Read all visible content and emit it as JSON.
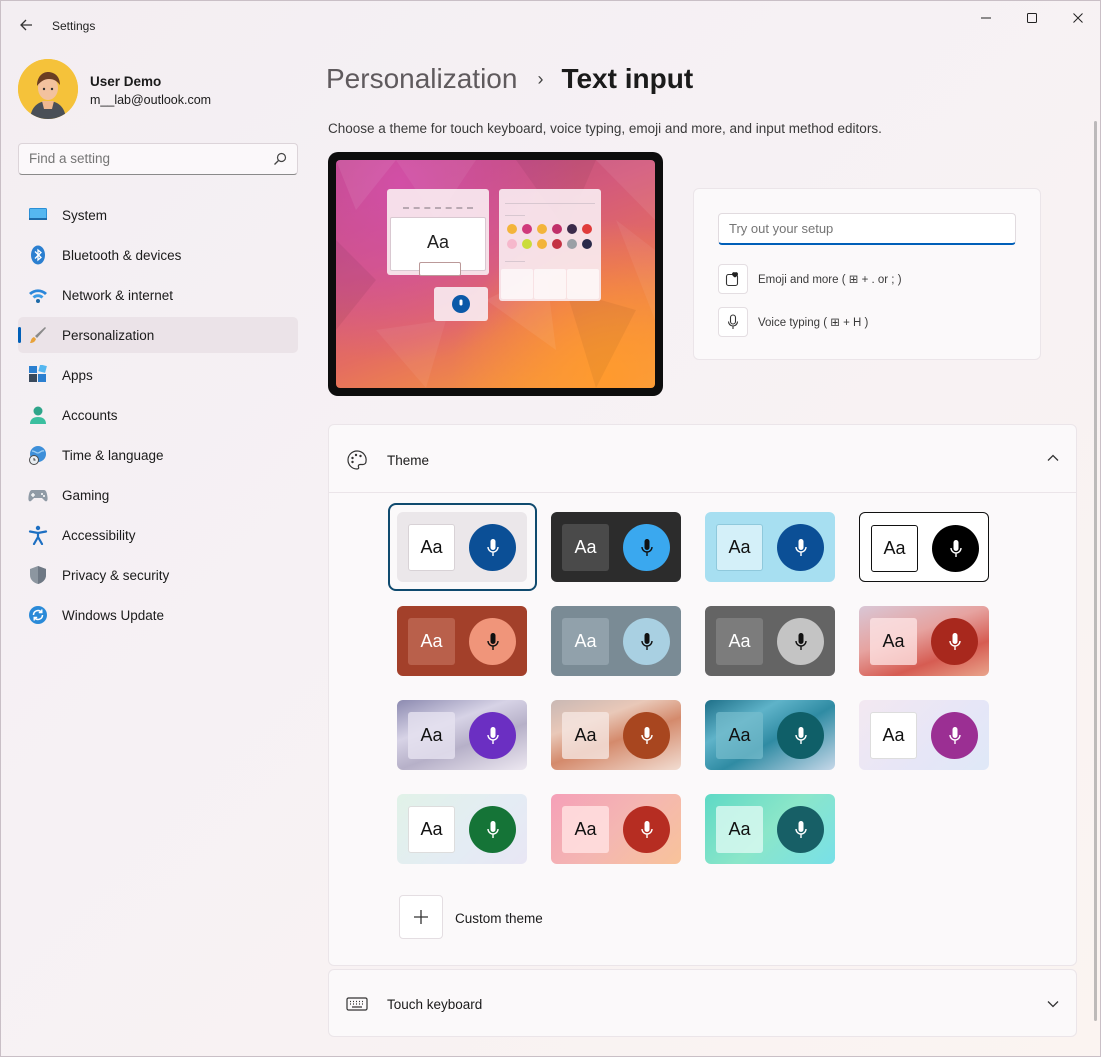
{
  "window": {
    "title": "Settings"
  },
  "profile": {
    "name": "User Demo",
    "email": "m__lab@outlook.com"
  },
  "search": {
    "placeholder": "Find a setting"
  },
  "nav": {
    "items": [
      {
        "label": "System",
        "icon": "monitor-icon",
        "selected": false
      },
      {
        "label": "Bluetooth & devices",
        "icon": "bluetooth-icon",
        "selected": false
      },
      {
        "label": "Network & internet",
        "icon": "wifi-icon",
        "selected": false
      },
      {
        "label": "Personalization",
        "icon": "brush-icon",
        "selected": true
      },
      {
        "label": "Apps",
        "icon": "apps-icon",
        "selected": false
      },
      {
        "label": "Accounts",
        "icon": "person-icon",
        "selected": false
      },
      {
        "label": "Time & language",
        "icon": "globe-clock-icon",
        "selected": false
      },
      {
        "label": "Gaming",
        "icon": "gamepad-icon",
        "selected": false
      },
      {
        "label": "Accessibility",
        "icon": "accessibility-icon",
        "selected": false
      },
      {
        "label": "Privacy & security",
        "icon": "shield-icon",
        "selected": false
      },
      {
        "label": "Windows Update",
        "icon": "update-icon",
        "selected": false
      }
    ]
  },
  "breadcrumb": {
    "parent": "Personalization",
    "separator": "›",
    "current": "Text input"
  },
  "description": "Choose a theme for touch keyboard, voice typing, emoji and more, and input method editors.",
  "preview": {
    "sample_text": "Aa"
  },
  "tryout": {
    "placeholder": "Try out your setup",
    "emoji_label": "Emoji and more ( ⊞ + . or ; )",
    "voice_label": "Voice typing ( ⊞ + H )"
  },
  "theme_section": {
    "title": "Theme",
    "swatch_text": "Aa",
    "custom_label": "Custom theme",
    "selected_index": 0
  },
  "touch_keyboard": {
    "title": "Touch keyboard"
  },
  "colors": {
    "accent": "#005fb8"
  }
}
